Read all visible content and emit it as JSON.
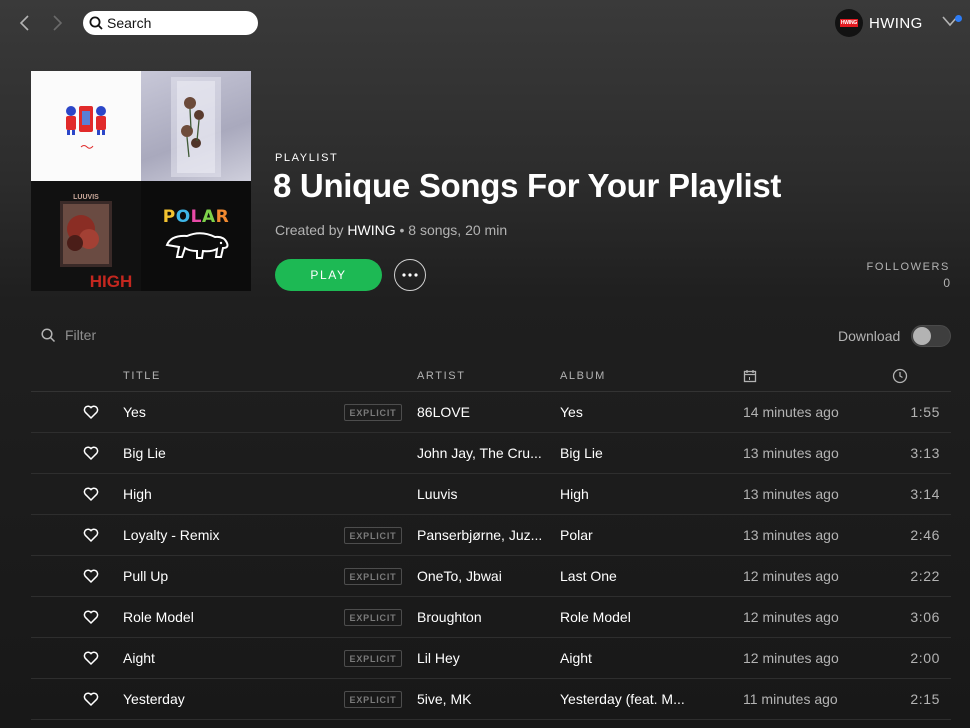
{
  "topbar": {
    "search_placeholder": "Search",
    "user_name": "HWING",
    "avatar_text": "HWING"
  },
  "playlist": {
    "type_label": "PLAYLIST",
    "title": "8 Unique Songs For Your Playlist",
    "created_by_prefix": "Created by",
    "owner": "HWING",
    "summary": " • 8 songs, 20 min",
    "play_label": "PLAY",
    "followers_label": "FOLLOWERS",
    "followers_count": "0",
    "cover_text": {
      "tile3_top": "LUUVIS",
      "tile3_bottom": "HIGH",
      "tile4": "POLAR"
    }
  },
  "controls": {
    "filter_placeholder": "Filter",
    "download_label": "Download",
    "download_enabled": false
  },
  "table": {
    "columns": {
      "title": "TITLE",
      "artist": "ARTIST",
      "album": "ALBUM",
      "date_icon": "calendar-icon",
      "duration_icon": "clock-icon"
    },
    "explicit_label": "EXPLICIT",
    "rows": [
      {
        "title": "Yes",
        "explicit": true,
        "artist": "86LOVE",
        "album": "Yes",
        "added": "14 minutes ago",
        "duration": "1:55"
      },
      {
        "title": "Big Lie",
        "explicit": false,
        "artist": "John Jay, The Cru...",
        "album": "Big Lie",
        "added": "13 minutes ago",
        "duration": "3:13"
      },
      {
        "title": "High",
        "explicit": false,
        "artist": "Luuvis",
        "album": "High",
        "added": "13 minutes ago",
        "duration": "3:14"
      },
      {
        "title": "Loyalty - Remix",
        "explicit": true,
        "artist": "Panserbjørne, Juz...",
        "album": "Polar",
        "added": "13 minutes ago",
        "duration": "2:46"
      },
      {
        "title": "Pull Up",
        "explicit": true,
        "artist": "OneTo, Jbwai",
        "album": "Last One",
        "added": "12 minutes ago",
        "duration": "2:22"
      },
      {
        "title": "Role Model",
        "explicit": true,
        "artist": "Broughton",
        "album": "Role Model",
        "added": "12 minutes ago",
        "duration": "3:06"
      },
      {
        "title": "Aight",
        "explicit": true,
        "artist": "Lil Hey",
        "album": "Aight",
        "added": "12 minutes ago",
        "duration": "2:00"
      },
      {
        "title": "Yesterday",
        "explicit": true,
        "artist": "5ive, MK",
        "album": "Yesterday (feat. M...",
        "added": "11 minutes ago",
        "duration": "2:15"
      }
    ]
  },
  "colors": {
    "accent": "#1db954",
    "notification": "#2d7cf6",
    "text_secondary": "#b3b3b3"
  }
}
